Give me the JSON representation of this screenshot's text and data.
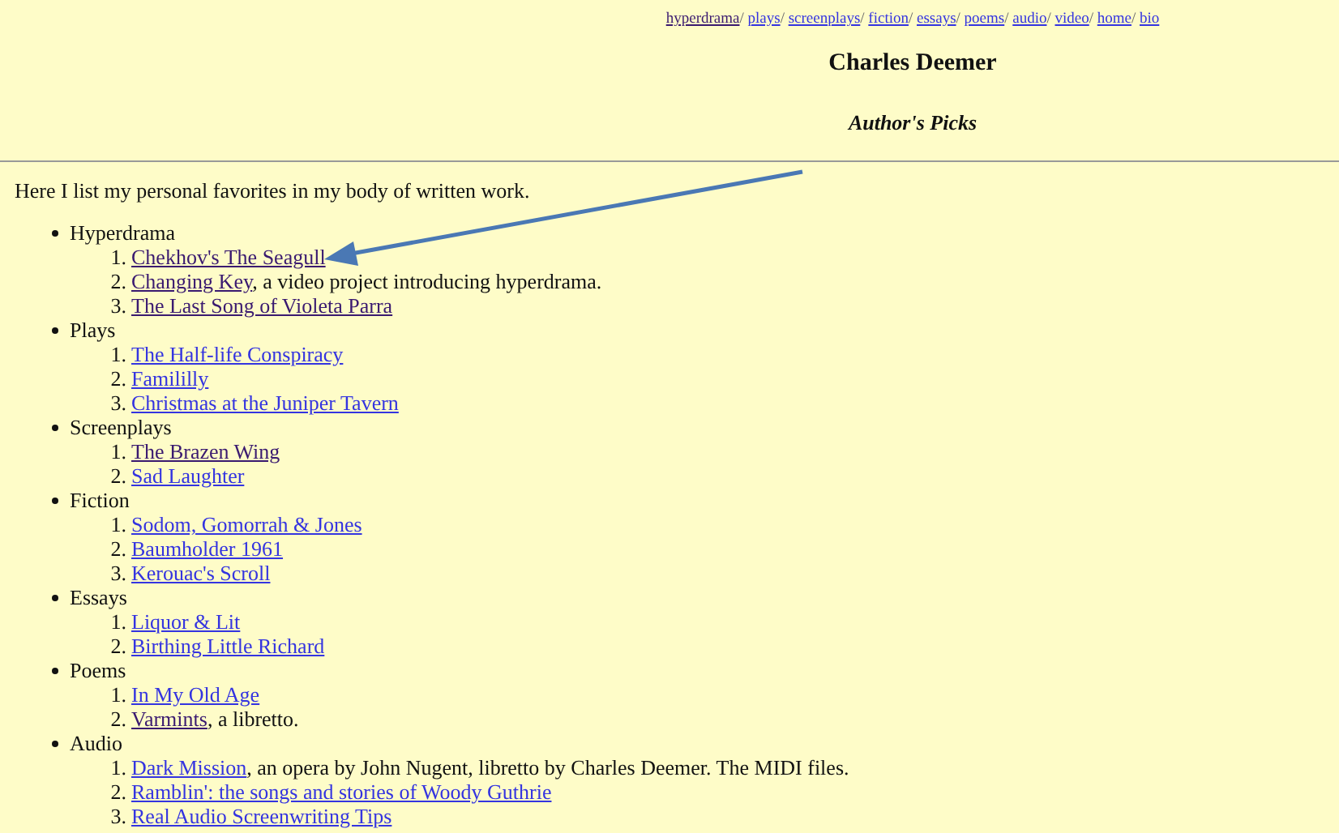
{
  "nav": {
    "separator": "/",
    "links": [
      {
        "label": "hyperdrama",
        "visited": true
      },
      {
        "label": "plays",
        "visited": false
      },
      {
        "label": "screenplays",
        "visited": false
      },
      {
        "label": "fiction",
        "visited": false
      },
      {
        "label": "essays",
        "visited": false
      },
      {
        "label": "poems",
        "visited": false
      },
      {
        "label": "audio",
        "visited": false
      },
      {
        "label": "video",
        "visited": false
      },
      {
        "label": "home",
        "visited": false
      },
      {
        "label": "bio",
        "visited": false
      }
    ]
  },
  "title": "Charles Deemer",
  "subtitle": "Author's Picks",
  "intro": "Here I list my personal favorites in my body of written work.",
  "categories": [
    {
      "name": "Hyperdrama",
      "items": [
        {
          "number": "1.",
          "link": "Chekhov's The Seagull",
          "visited": true
        },
        {
          "number": "2.",
          "link": "Changing Key",
          "note": ", a video project introducing hyperdrama.",
          "visited": true
        },
        {
          "number": "3.",
          "link": "The Last Song of Violeta Parra",
          "visited": true
        }
      ]
    },
    {
      "name": "Plays",
      "items": [
        {
          "number": "1.",
          "link": "The Half-life Conspiracy",
          "visited": false
        },
        {
          "number": "2.",
          "link": "Famililly",
          "visited": false
        },
        {
          "number": "3.",
          "link": "Christmas at the Juniper Tavern",
          "visited": false
        }
      ]
    },
    {
      "name": "Screenplays",
      "items": [
        {
          "number": "1.",
          "link": "The Brazen Wing",
          "visited": true
        },
        {
          "number": "2.",
          "link": "Sad Laughter",
          "visited": false
        }
      ]
    },
    {
      "name": "Fiction",
      "items": [
        {
          "number": "1.",
          "link": "Sodom, Gomorrah & Jones",
          "visited": false
        },
        {
          "number": "2.",
          "link": "Baumholder 1961",
          "visited": false
        },
        {
          "number": "3.",
          "link": "Kerouac's Scroll",
          "visited": false
        }
      ]
    },
    {
      "name": "Essays",
      "items": [
        {
          "number": "1.",
          "link": "Liquor & Lit",
          "visited": false
        },
        {
          "number": "2.",
          "link": "Birthing Little Richard",
          "visited": false
        }
      ]
    },
    {
      "name": "Poems",
      "items": [
        {
          "number": "1.",
          "link": "In My Old Age",
          "visited": false
        },
        {
          "number": "2.",
          "link": "Varmints",
          "note": ", a libretto.",
          "visited": true
        }
      ]
    },
    {
      "name": "Audio",
      "items": [
        {
          "number": "1.",
          "link": "Dark Mission",
          "note": ", an opera by John Nugent, libretto by Charles Deemer. The MIDI files.",
          "visited": false
        },
        {
          "number": "2.",
          "link": "Ramblin': the songs and stories of Woody Guthrie",
          "visited": false
        },
        {
          "number": "3.",
          "link": "Real Audio Screenwriting Tips",
          "visited": false
        }
      ]
    }
  ]
}
